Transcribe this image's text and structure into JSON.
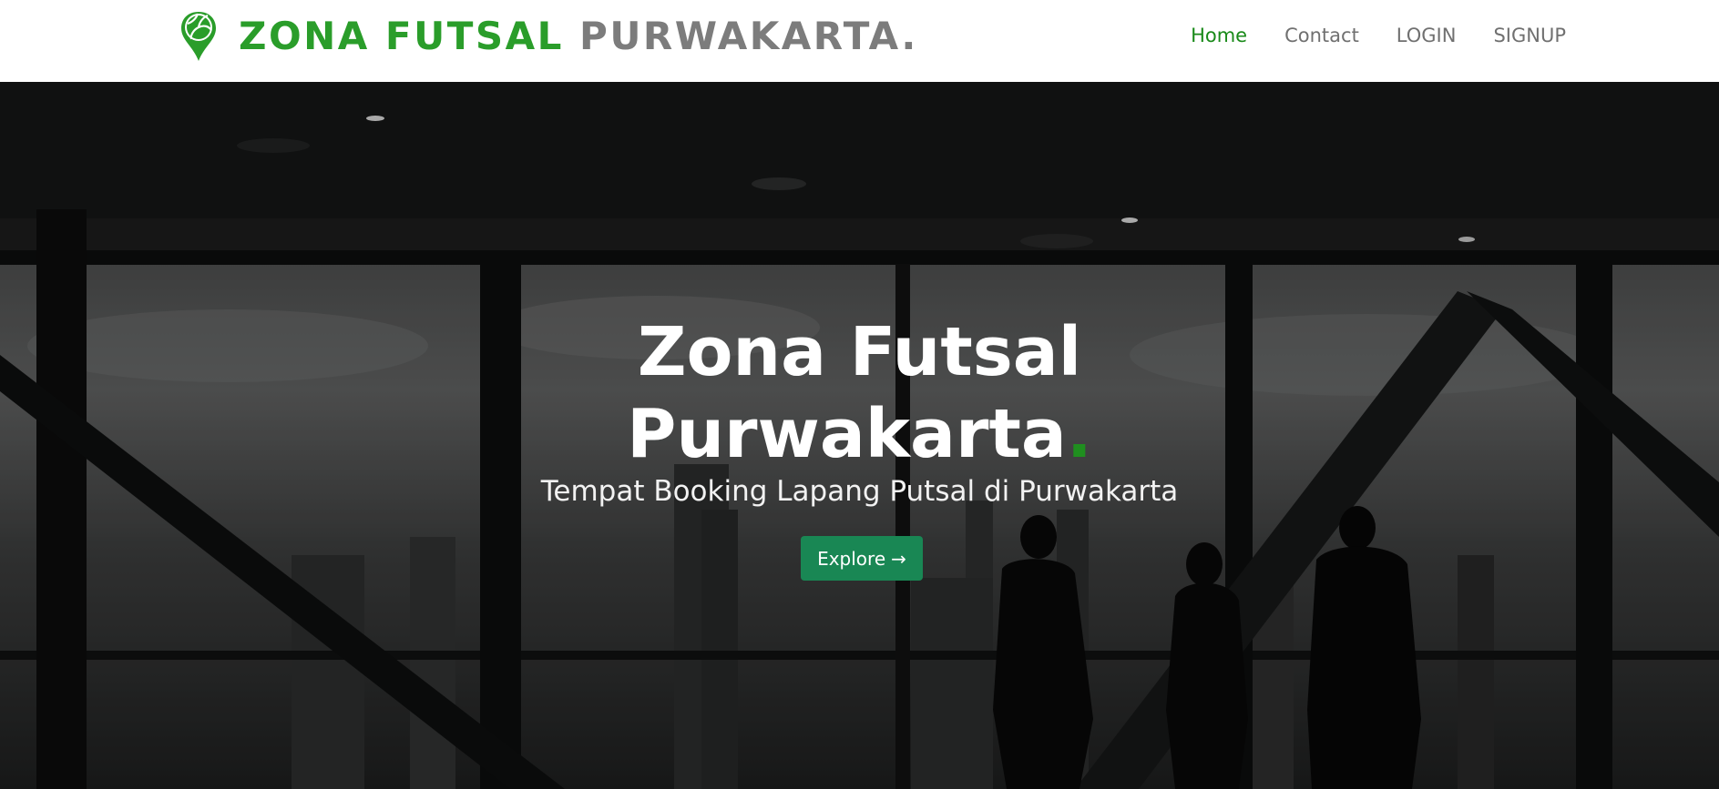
{
  "brand": {
    "name_primary": "ZONA FUTSAL",
    "name_secondary": "PURWAKARTA.",
    "logo_icon": "futsal-ball-pin-icon"
  },
  "nav": {
    "items": [
      {
        "label": "Home",
        "active": true
      },
      {
        "label": "Contact",
        "active": false
      },
      {
        "label": "LOGIN",
        "active": false
      },
      {
        "label": "SIGNUP",
        "active": false
      }
    ]
  },
  "hero": {
    "title_line1": "Zona Futsal",
    "title_line2": "Purwakarta",
    "title_dot": ".",
    "subtitle": "Tempat Booking Lapang Putsal di Purwakarta",
    "cta_label": "Explore",
    "cta_icon": "arrow-right-icon"
  },
  "colors": {
    "accent_green": "#2a9d2a",
    "nav_active": "#198a19",
    "button_green": "#198754",
    "brand_gray": "#7c7c7c"
  }
}
